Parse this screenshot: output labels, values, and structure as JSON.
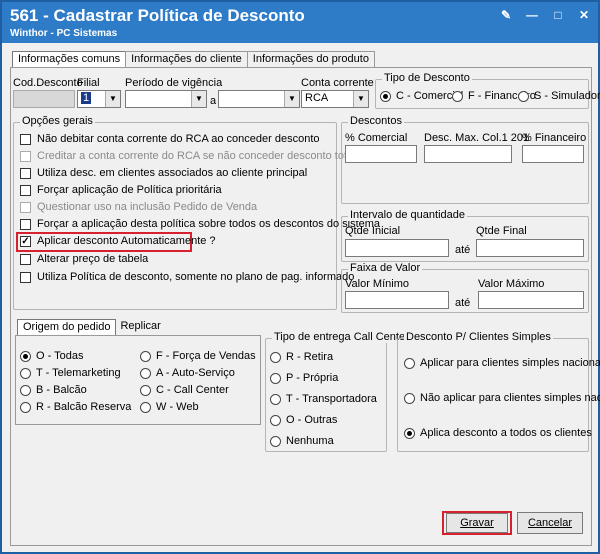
{
  "window": {
    "title": "561 - Cadastrar Política de Desconto",
    "subtitle": "Winthor - PC Sistemas",
    "controls": [
      "edit-icon",
      "minimize-icon",
      "maximize-icon",
      "close-icon"
    ]
  },
  "tabs": [
    "Informações comuns",
    "Informações do cliente",
    "Informações do produto"
  ],
  "header": {
    "cod_desconto_label": "Cod.Desconto",
    "filial_label": "Filial",
    "filial_value": "1",
    "periodo_label": "Período de vigência",
    "periodo_sep": "a",
    "conta_label": "Conta corrente",
    "conta_value": "RCA"
  },
  "tipo_desconto": {
    "legend": "Tipo de Desconto",
    "options": [
      "C - Comercial",
      "F - Financeiro",
      "S - Simulador"
    ],
    "selected": 0
  },
  "opcoes_gerais": {
    "legend": "Opções gerais",
    "items": [
      {
        "label": "Não debitar conta corrente do RCA ao conceder desconto",
        "checked": false,
        "disabled": false
      },
      {
        "label": "Creditar a conta corrente do RCA se não conceder desconto total",
        "checked": false,
        "disabled": true
      },
      {
        "label": "Utiliza desc. em clientes associados ao cliente principal",
        "checked": false,
        "disabled": false
      },
      {
        "label": "Forçar aplicação de Política prioritária",
        "checked": false,
        "disabled": false
      },
      {
        "label": "Questionar uso na inclusão Pedido de Venda",
        "checked": false,
        "disabled": true
      },
      {
        "label": "Forçar a aplicação desta política sobre todos os descontos do sistema",
        "checked": false,
        "disabled": false
      },
      {
        "label": "Aplicar desconto Automaticamente ?",
        "checked": true,
        "disabled": false
      },
      {
        "label": "Alterar preço de tabela",
        "checked": false,
        "disabled": false
      },
      {
        "label": "Utiliza Política de desconto, somente no plano de pag. informado",
        "checked": false,
        "disabled": false
      }
    ]
  },
  "descontos": {
    "legend": "Descontos",
    "col1": "% Comercial",
    "col2": "Desc. Max. Col.1 201",
    "col3": "% Financeiro"
  },
  "intervalo": {
    "legend": "Intervalo de quantidade",
    "inicial": "Qtde Inicial",
    "final": "Qtde Final",
    "sep": "até"
  },
  "faixa": {
    "legend": "Faixa de Valor",
    "minimo": "Valor Mínimo",
    "maximo": "Valor Máximo",
    "sep": "até"
  },
  "subtabs": [
    "Origem do pedido",
    "Replicar"
  ],
  "origem": {
    "col1": [
      "O - Todas",
      "T - Telemarketing",
      "B - Balcão",
      "R - Balcão Reserva"
    ],
    "col2": [
      "F - Força de Vendas",
      "A - Auto-Serviço",
      "C - Call Center",
      "W - Web"
    ],
    "selected": "O - Todas"
  },
  "entrega": {
    "legend": "Tipo de entrega Call Center",
    "options": [
      "R - Retira",
      "P - Própria",
      "T - Transportadora",
      "O - Outras",
      "Nenhuma"
    ]
  },
  "clientes_simples": {
    "legend": "Desconto P/ Clientes Simples",
    "options": [
      "Aplicar para clientes simples nacional",
      "Não aplicar para clientes simples nacional",
      "Aplica desconto a todos os clientes"
    ],
    "selected": 2
  },
  "buttons": {
    "gravar": "Gravar",
    "cancelar": "Cancelar"
  },
  "colors": {
    "titlebar": "#2e7cc8",
    "highlight": "#d7212f"
  }
}
